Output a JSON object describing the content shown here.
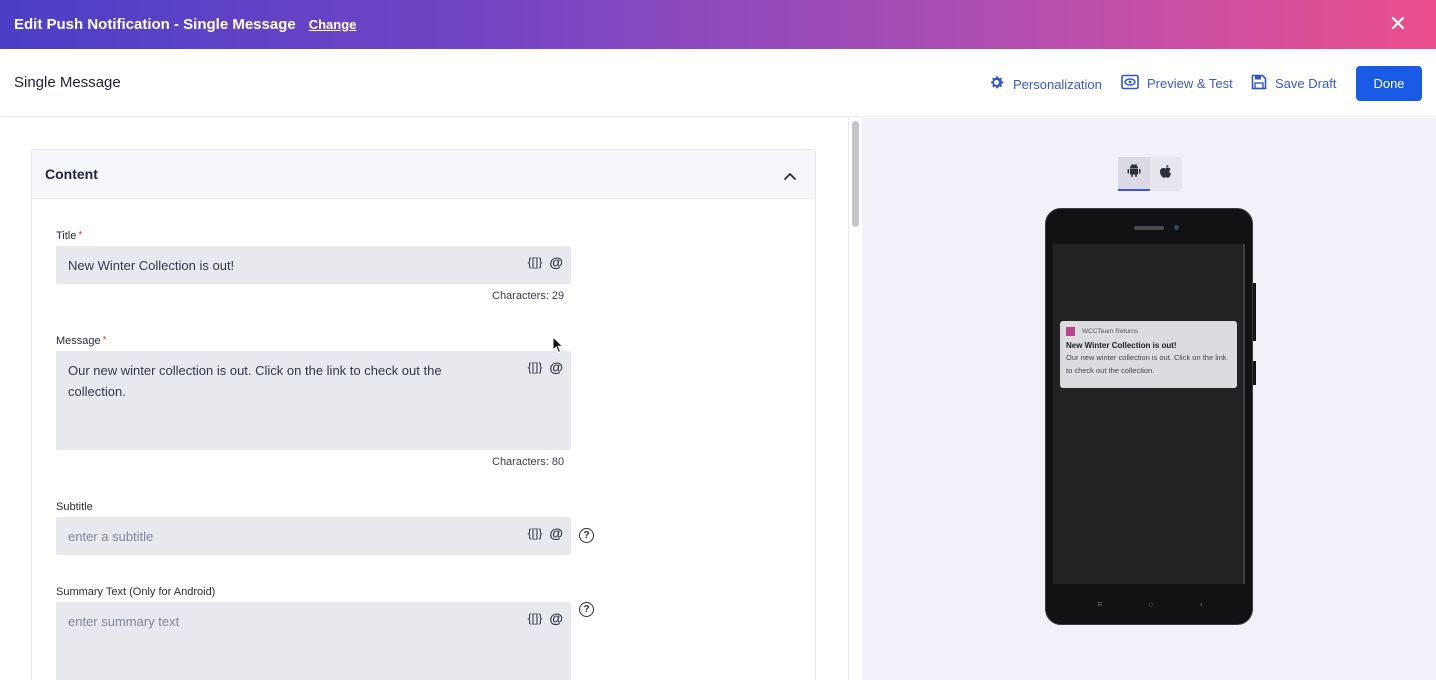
{
  "banner": {
    "title": "Edit Push Notification - Single Message",
    "change_label": "Change"
  },
  "header": {
    "title": "Single Message",
    "personalization_label": "Personalization",
    "preview_label": "Preview & Test",
    "save_draft_label": "Save Draft",
    "done_label": "Done"
  },
  "content": {
    "section_title": "Content",
    "title_field": {
      "label": "Title",
      "required_mark": "*",
      "value": "New Winter Collection is out!",
      "counter": "Characters: 29"
    },
    "message_field": {
      "label": "Message",
      "required_mark": "*",
      "value": "Our new winter collection is out. Click on the link to check out the collection.",
      "counter": "Characters: 80"
    },
    "subtitle_field": {
      "label": "Subtitle",
      "placeholder": "enter a subtitle"
    },
    "summary_field": {
      "label": "Summary Text (Only for Android)",
      "placeholder": "enter summary text"
    },
    "token_button_label": "{[]}",
    "mention_button_label": "@",
    "help_label": "?"
  },
  "preview": {
    "platforms": [
      "android",
      "apple"
    ],
    "active_platform": "android",
    "notification": {
      "app_name": "WCCTeam Returns",
      "title": "New Winter Collection is out!",
      "body": "Our new winter collection is out. Click on the link to check out the collection."
    },
    "nav_glyphs": [
      "≡",
      "○",
      "‹"
    ]
  },
  "colors": {
    "accent": "#1a5be6",
    "link": "#3b57d6",
    "banner_start": "#4b3fc7",
    "banner_end": "#ec4f8e",
    "app_icon": "#b8448c"
  }
}
